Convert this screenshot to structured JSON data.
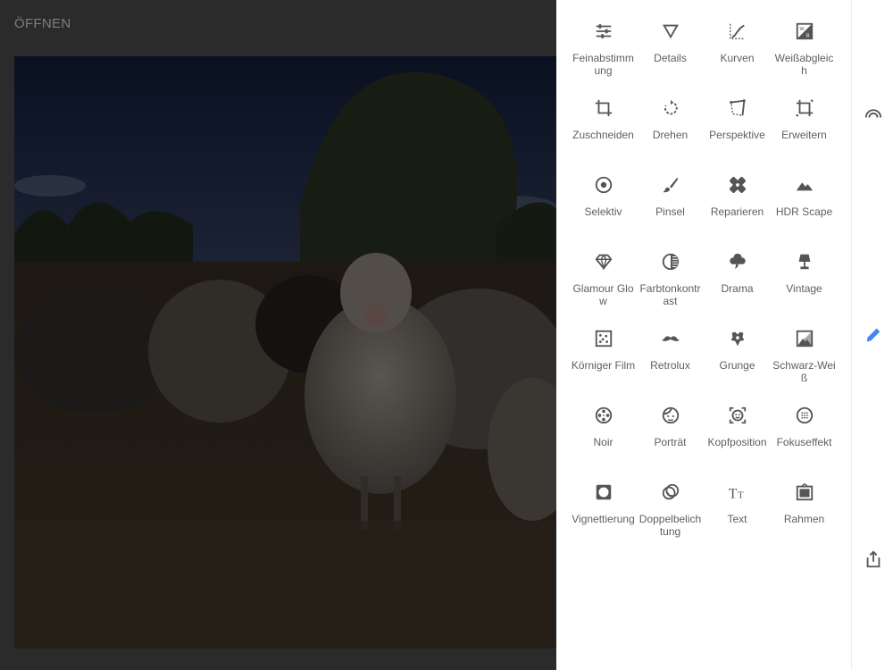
{
  "header": {
    "open_label": "ÖFFNEN"
  },
  "colors": {
    "icon": "#555555",
    "label": "#5f5f5f",
    "accent": "#4285f4",
    "panel_bg": "#ffffff"
  },
  "tools": [
    {
      "label": "Feinabstimmung",
      "icon": "sliders-icon"
    },
    {
      "label": "Details",
      "icon": "triangle-down-icon"
    },
    {
      "label": "Kurven",
      "icon": "curves-icon"
    },
    {
      "label": "Weißabgleich",
      "icon": "white-balance-icon"
    },
    {
      "label": "Zuschneiden",
      "icon": "crop-icon"
    },
    {
      "label": "Drehen",
      "icon": "rotate-icon"
    },
    {
      "label": "Perspektive",
      "icon": "perspective-icon"
    },
    {
      "label": "Erweitern",
      "icon": "expand-icon"
    },
    {
      "label": "Selektiv",
      "icon": "selective-icon"
    },
    {
      "label": "Pinsel",
      "icon": "brush-icon"
    },
    {
      "label": "Reparieren",
      "icon": "healing-icon"
    },
    {
      "label": "HDR Scape",
      "icon": "mountain-icon"
    },
    {
      "label": "Glamour Glow",
      "icon": "diamond-icon"
    },
    {
      "label": "Farbtonkontrast",
      "icon": "tonal-contrast-icon"
    },
    {
      "label": "Drama",
      "icon": "cloud-icon"
    },
    {
      "label": "Vintage",
      "icon": "lamp-icon"
    },
    {
      "label": "Körniger Film",
      "icon": "grain-icon"
    },
    {
      "label": "Retrolux",
      "icon": "mustache-icon"
    },
    {
      "label": "Grunge",
      "icon": "grunge-icon"
    },
    {
      "label": "Schwarz-Weiß",
      "icon": "bw-icon"
    },
    {
      "label": "Noir",
      "icon": "film-reel-icon"
    },
    {
      "label": "Porträt",
      "icon": "face-icon"
    },
    {
      "label": "Kopfposition",
      "icon": "head-pose-icon"
    },
    {
      "label": "Fokuseffekt",
      "icon": "lens-blur-icon"
    },
    {
      "label": "Vignettierung",
      "icon": "vignette-icon"
    },
    {
      "label": "Doppelbelichtung",
      "icon": "double-exposure-icon"
    },
    {
      "label": "Text",
      "icon": "text-icon"
    },
    {
      "label": "Rahmen",
      "icon": "frame-icon"
    }
  ],
  "rail": [
    {
      "name": "looks-icon"
    },
    {
      "name": "edit-pencil-icon",
      "active": true
    },
    {
      "name": "share-icon"
    }
  ]
}
